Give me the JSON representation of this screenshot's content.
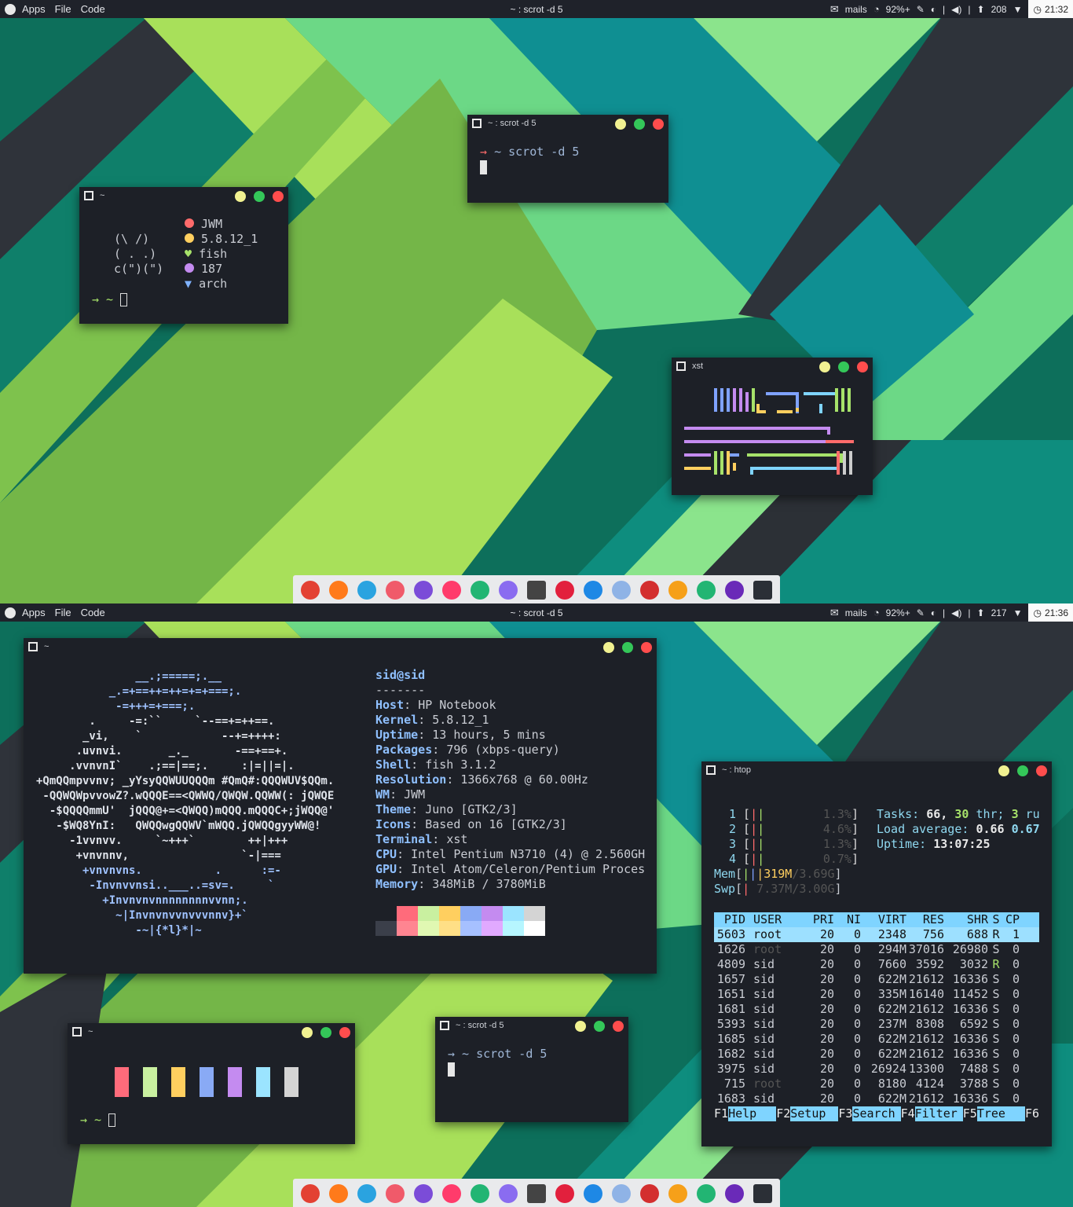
{
  "colors": {
    "bar_bg": "#1f222a",
    "accent_blue": "#7fd4ff",
    "red": "#ff6b6b",
    "green": "#a7e26a",
    "yellow": "#ffcf5f",
    "purple": "#c48bf0"
  },
  "top": {
    "topbar": {
      "apps": "Apps",
      "file": "File",
      "code": "Code",
      "title": "~ : scrot -d 5",
      "mails": "mails",
      "battery": "92%+",
      "sep": "|",
      "updates": "208",
      "clock": "21:32"
    },
    "win_scrot": {
      "title": "~ : scrot -d 5",
      "prompt_arrow": "→",
      "prompt": "~ scrot -d 5"
    },
    "win_fetch": {
      "title": "~",
      "art1": "(\\ /)",
      "art2": "( . .)",
      "art3": "c(\")(\")",
      "wm": "JWM",
      "kernel": "5.8.12_1",
      "shell": "fish",
      "pkgs": "187",
      "distro": "arch",
      "prompt": "→ ~"
    },
    "win_xst": {
      "title": "xst"
    }
  },
  "bottom": {
    "topbar": {
      "apps": "Apps",
      "file": "File",
      "code": "Code",
      "title": "~ : scrot -d 5",
      "mails": "mails",
      "battery": "92%+",
      "sep": "|",
      "updates": "217",
      "clock": "21:36"
    },
    "neofetch": {
      "title": "~",
      "art": [
        "               __.;=====;.__",
        "           _.=+==++=++=+=+===;.",
        "            -=+++=+===;.",
        "        .     -=:``     `--==+=++==.",
        "       _vi,    `            --+=++++:",
        "      .uvnvi.       _._       -==+==+.",
        "     .vvnvnI`    .;==|==;.     :|=||=|.",
        "+QmQQmpvvnv; _yYsyQQWUUQQQm #QmQ#:QQQWUV$QQm.",
        " -QQWQWpvvowZ?.wQQQE==<QWWQ/QWQW.QQWW(: jQWQE",
        "  -$QQQQmmU'  jQQQ@+=<QWQQ)mQQQ.mQQQC+;jWQQ@'",
        "   -$WQ8YnI:   QWQQwgQQWV`mWQQ.jQWQQgyyWW@!",
        "     -1vvnvv.     `~+++`        ++|+++",
        "      +vnvnnv,                 `-|===",
        "       +vnvnvns.           .      :=-",
        "        -Invnvvnsi..___..=sv=.     `",
        "          +Invnvnvnnnnnnnnvvnn;.",
        "            ~|Invnvnvvnvvvnnv}+`",
        "               -~|{*l}*|~"
      ],
      "user": "sid@sid",
      "dashes": "-------",
      "info": [
        {
          "k": "Host",
          "v": "HP Notebook"
        },
        {
          "k": "Kernel",
          "v": "5.8.12_1"
        },
        {
          "k": "Uptime",
          "v": "13 hours, 5 mins"
        },
        {
          "k": "Packages",
          "v": "796 (xbps-query)"
        },
        {
          "k": "Shell",
          "v": "fish 3.1.2"
        },
        {
          "k": "Resolution",
          "v": "1366x768 @ 60.00Hz"
        },
        {
          "k": "WM",
          "v": "JWM"
        },
        {
          "k": "Theme",
          "v": "Juno [GTK2/3]"
        },
        {
          "k": "Icons",
          "v": "Based on 16 [GTK2/3]"
        },
        {
          "k": "Terminal",
          "v": "xst"
        },
        {
          "k": "CPU",
          "v": "Intel Pentium N3710 (4) @ 2.560GH"
        },
        {
          "k": "GPU",
          "v": "Intel Atom/Celeron/Pentium Proces"
        },
        {
          "k": "Memory",
          "v": "348MiB / 3780MiB"
        }
      ]
    },
    "htop": {
      "title": "~ : htop",
      "cpus": [
        {
          "n": "1",
          "pct": "1.3%"
        },
        {
          "n": "2",
          "pct": "4.6%"
        },
        {
          "n": "3",
          "pct": "1.3%"
        },
        {
          "n": "4",
          "pct": "0.7%"
        }
      ],
      "mem_label": "Mem",
      "mem_used": "319M",
      "mem_total": "/3.69G",
      "swp_label": "Swp",
      "swp_val": "7.37M/3.00G",
      "tasks_label": "Tasks:",
      "tasks_val": "66,",
      "thr_val": "30",
      "thr_label": "thr;",
      "run_val": "3",
      "run_label": "ru",
      "load_label": "Load average:",
      "load1": "0.66",
      "load2": "0.67",
      "uptime_label": "Uptime:",
      "uptime_val": "13:07:25",
      "header": [
        "PID",
        "USER",
        "PRI",
        "NI",
        "VIRT",
        "RES",
        "SHR",
        "S",
        "CP"
      ],
      "rows": [
        [
          "5603",
          "root",
          "20",
          "0",
          "2348",
          "756",
          "688",
          "R",
          "1"
        ],
        [
          "1626",
          "root",
          "20",
          "0",
          "294M",
          "37016",
          "26980",
          "S",
          "0"
        ],
        [
          "4809",
          "sid",
          "20",
          "0",
          "7660",
          "3592",
          "3032",
          "R",
          "0"
        ],
        [
          "1657",
          "sid",
          "20",
          "0",
          "622M",
          "21612",
          "16336",
          "S",
          "0"
        ],
        [
          "1651",
          "sid",
          "20",
          "0",
          "335M",
          "16140",
          "11452",
          "S",
          "0"
        ],
        [
          "1681",
          "sid",
          "20",
          "0",
          "622M",
          "21612",
          "16336",
          "S",
          "0"
        ],
        [
          "5393",
          "sid",
          "20",
          "0",
          "237M",
          "8308",
          "6592",
          "S",
          "0"
        ],
        [
          "1685",
          "sid",
          "20",
          "0",
          "622M",
          "21612",
          "16336",
          "S",
          "0"
        ],
        [
          "1682",
          "sid",
          "20",
          "0",
          "622M",
          "21612",
          "16336",
          "S",
          "0"
        ],
        [
          "3975",
          "sid",
          "20",
          "0",
          "26924",
          "13300",
          "7488",
          "S",
          "0"
        ],
        [
          "715",
          "root",
          "20",
          "0",
          "8180",
          "4124",
          "3788",
          "S",
          "0"
        ],
        [
          "1683",
          "sid",
          "20",
          "0",
          "622M",
          "21612",
          "16336",
          "S",
          "0"
        ]
      ],
      "fkeys": [
        {
          "k": "F1",
          "l": "Help"
        },
        {
          "k": "F2",
          "l": "Setup"
        },
        {
          "k": "F3",
          "l": "Search"
        },
        {
          "k": "F4",
          "l": "Filter"
        },
        {
          "k": "F5",
          "l": "Tree"
        },
        {
          "k": "F6",
          "l": ""
        }
      ]
    },
    "win_colors": {
      "title": "~",
      "prompt": "→ ~"
    },
    "win_scrot": {
      "title": "~ : scrot -d 5",
      "prompt": "→ ~ scrot -d 5"
    }
  },
  "dock_icons": [
    "chrome-icon",
    "firefox-icon",
    "telegram-icon",
    "browser-icon",
    "share-icon",
    "media-player-icon",
    "chat-icon",
    "mail-icon",
    "calculator-icon",
    "screen-recorder-icon",
    "messenger-icon",
    "network-icon",
    "pdf-icon",
    "weather-icon",
    "vpn-icon",
    "audio-icon",
    "terminal-icon"
  ]
}
